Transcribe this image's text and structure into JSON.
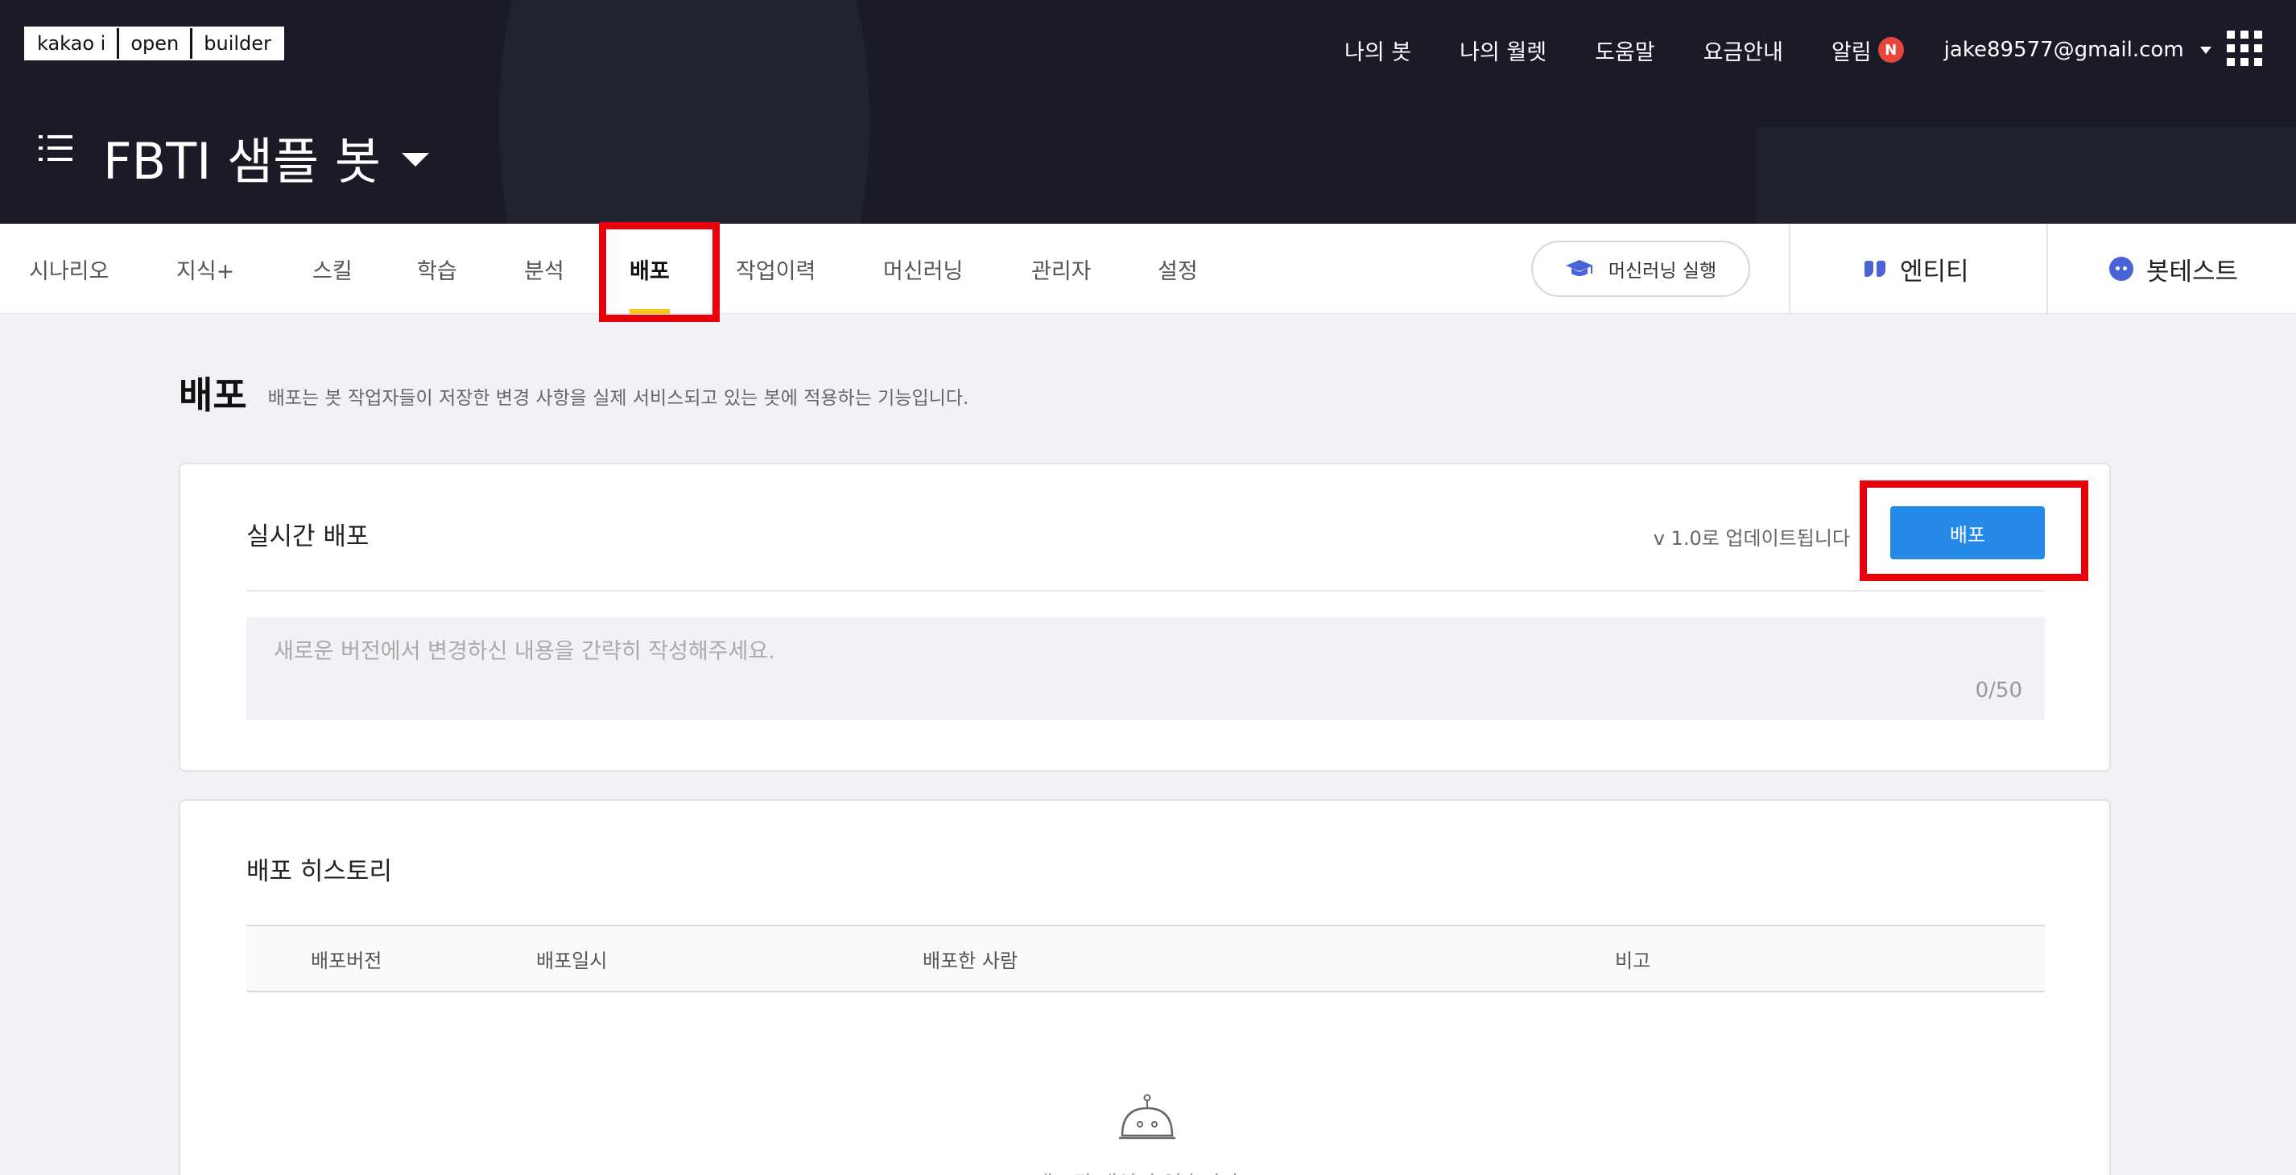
{
  "logo": {
    "part1": "kakao i",
    "part2": "open",
    "part3": "builder"
  },
  "topnav": {
    "items": [
      "나의 봇",
      "나의 월렛",
      "도움말",
      "요금안내"
    ],
    "alarm_label": "알림",
    "alarm_badge": "N",
    "account": "jake89577@gmail.com"
  },
  "bot": {
    "title": "FBTI 샘플 봇"
  },
  "tabs": [
    {
      "label": "시나리오"
    },
    {
      "label": "지식+"
    },
    {
      "label": "스킬"
    },
    {
      "label": "학습"
    },
    {
      "label": "분석"
    },
    {
      "label": "배포",
      "active": true
    },
    {
      "label": "작업이력"
    },
    {
      "label": "머신러닝"
    },
    {
      "label": "관리자"
    },
    {
      "label": "설정"
    }
  ],
  "ml_run": {
    "label": "머신러닝 실행"
  },
  "side_tabs": {
    "entity": "엔티티",
    "bottest": "봇테스트"
  },
  "page": {
    "title": "배포",
    "description": "배포는 봇 작업자들이 저장한 변경 사항을 실제 서비스되고 있는 봇에 적용하는 기능입니다."
  },
  "realtime": {
    "title": "실시간 배포",
    "version_text": "v 1.0로 업데이트됩니다",
    "deploy_button": "배포",
    "memo_placeholder": "새로운 버전에서 변경하신 내용을 간략히 작성해주세요.",
    "memo_value": "",
    "memo_counter": "0/50"
  },
  "history": {
    "title": "배포 히스토리",
    "columns": [
      "배포버전",
      "배포일시",
      "배포한 사람",
      "비고"
    ],
    "rows": [],
    "empty_text": "배포된 내역이 없습니다"
  },
  "colors": {
    "header_bg": "#1a1b27",
    "accent_blue": "#2589e8",
    "active_tab_underline": "#f5c518",
    "alarm_badge": "#e8463d",
    "highlight_box": "#e8000b",
    "icon_blue": "#4a64d8"
  },
  "icons": {
    "menu": "list-menu-icon",
    "dropdown": "caret-down-icon",
    "apps": "grid-apps-icon",
    "ml_run": "graduation-cap-icon",
    "entity": "quote-icon",
    "bottest": "bot-face-icon",
    "empty": "robot-icon"
  }
}
